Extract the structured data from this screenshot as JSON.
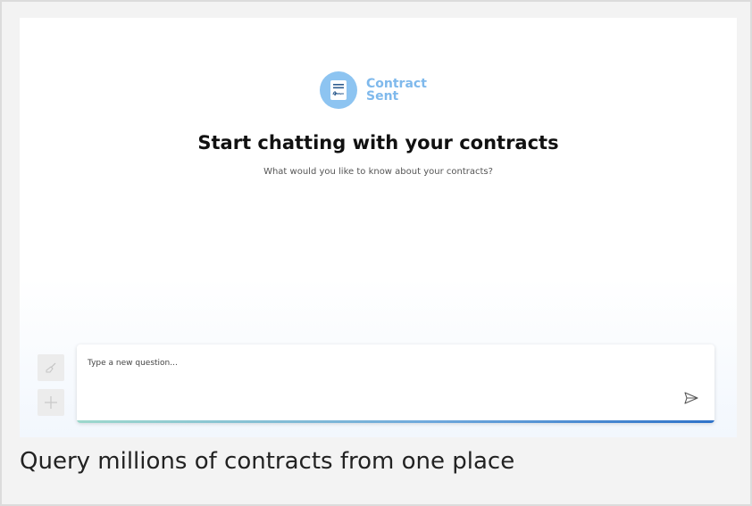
{
  "brand": {
    "line1": "Contract",
    "line2": "Sent",
    "color": "#7fb9ec",
    "icon": "contract-document-icon"
  },
  "main": {
    "title": "Start chatting with your contracts",
    "subtitle": "What would you like to know about your contracts?"
  },
  "chat": {
    "placeholder": "Type a new question...",
    "value": "",
    "clear_icon": "broom-icon",
    "new_icon": "plus-icon",
    "send_icon": "send-icon",
    "accent_gradient": [
      "#9dd8cc",
      "#6fa9dc",
      "#2f73c9"
    ]
  },
  "caption": {
    "text": "Query millions of contracts from one place"
  }
}
